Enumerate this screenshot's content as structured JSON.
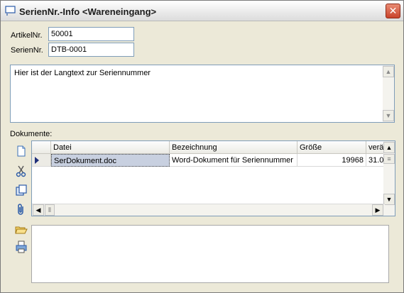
{
  "window": {
    "title": "SerienNr.-Info <Wareneingang>"
  },
  "fields": {
    "artikel_label": "ArtikelNr.",
    "artikel_value": "50001",
    "serien_label": "SerienNr.",
    "serien_value": "DTB-0001"
  },
  "memo": {
    "text": "Hier ist der Langtext zur Seriennummer"
  },
  "documents": {
    "label": "Dokumente:",
    "columns": [
      "Datei",
      "Bezeichnung",
      "Größe",
      "verä"
    ],
    "rows": [
      {
        "datei": "SerDokument.doc",
        "bezeichnung": "Word-Dokument für Seriennummer",
        "groesse": "19968",
        "veraendert": "31.0"
      }
    ]
  },
  "icons": {
    "new": "new-document-icon",
    "cut": "scissors-icon",
    "copy": "copy-icon",
    "attach": "paperclip-icon",
    "open": "folder-open-icon",
    "print": "printer-icon"
  }
}
